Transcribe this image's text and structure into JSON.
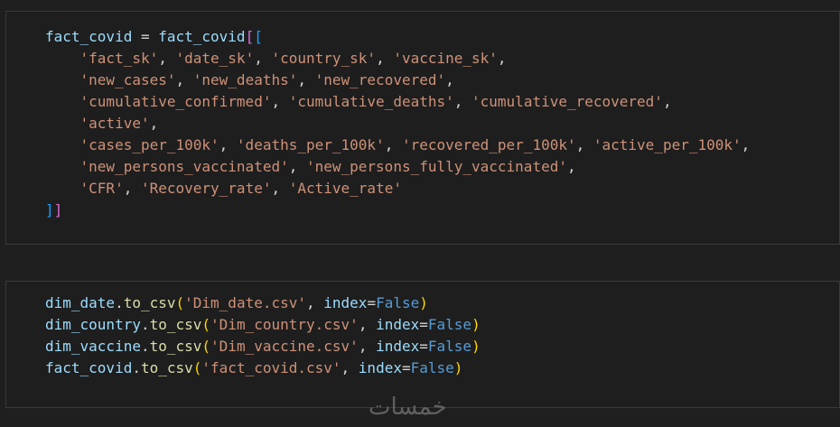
{
  "cell1": {
    "line1": {
      "var": "fact_covid",
      "op": " = ",
      "obj": "fact_covid",
      "open": "[["
    },
    "line2": [
      "'fact_sk'",
      ", ",
      "'date_sk'",
      ", ",
      "'country_sk'",
      ", ",
      "'vaccine_sk'",
      ","
    ],
    "line3": [
      "'new_cases'",
      ", ",
      "'new_deaths'",
      ", ",
      "'new_recovered'",
      ","
    ],
    "line4": [
      "'cumulative_confirmed'",
      ", ",
      "'cumulative_deaths'",
      ", ",
      "'cumulative_recovered'",
      ","
    ],
    "line5": [
      "'active'",
      ","
    ],
    "line6": [
      "'cases_per_100k'",
      ", ",
      "'deaths_per_100k'",
      ", ",
      "'recovered_per_100k'",
      ", ",
      "'active_per_100k'",
      ","
    ],
    "line7": [
      "'new_persons_vaccinated'",
      ", ",
      "'new_persons_fully_vaccinated'",
      ","
    ],
    "line8": [
      "'CFR'",
      ", ",
      "'Recovery_rate'",
      ", ",
      "'Active_rate'"
    ],
    "line9": {
      "close": "]]"
    }
  },
  "cell2": {
    "lines": [
      {
        "obj": "dim_date",
        "dot": ".",
        "fn": "to_csv",
        "arg": "'Dim_date.csv'",
        "kw": "index",
        "eq": "=",
        "val": "False"
      },
      {
        "obj": "dim_country",
        "dot": ".",
        "fn": "to_csv",
        "arg": "'Dim_country.csv'",
        "kw": "index",
        "eq": "=",
        "val": "False"
      },
      {
        "obj": "dim_vaccine",
        "dot": ".",
        "fn": "to_csv",
        "arg": "'Dim_vaccine.csv'",
        "kw": "index",
        "eq": "=",
        "val": "False"
      },
      {
        "obj": "fact_covid",
        "dot": ".",
        "fn": "to_csv",
        "arg": "'fact_covid.csv'",
        "kw": "index",
        "eq": "=",
        "val": "False"
      }
    ],
    "open_paren": "(",
    "comma": ", ",
    "close_paren": ")"
  },
  "watermark": {
    "text": "خمسات"
  },
  "colors": {
    "background": "#1f1f1f",
    "cell_background": "#1e1e1e",
    "variable": "#9cdcfe",
    "string": "#ce9178",
    "keyword_value": "#569cd6",
    "bracket_outer": "#da70d6",
    "bracket_inner": "#179fff",
    "paren": "#ffd700"
  }
}
